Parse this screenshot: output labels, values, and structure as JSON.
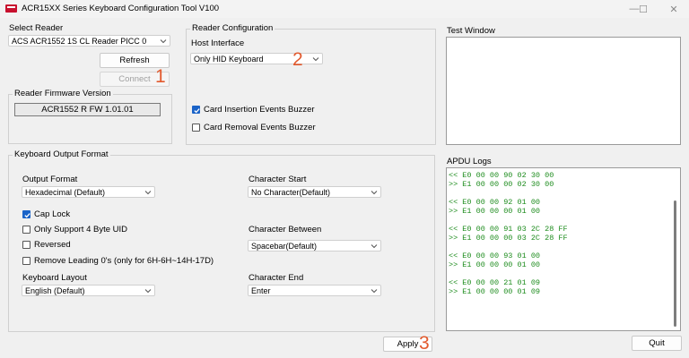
{
  "window": {
    "title": "ACR15XX Series Keyboard Configuration Tool V100",
    "minimize": "—",
    "maximize": "☐",
    "close": "✕"
  },
  "select_reader": {
    "title": "Select Reader",
    "reader_value": "ACS ACR1552 1S CL Reader PICC 0",
    "refresh_label": "Refresh",
    "connect_label": "Connect",
    "firmware_title": "Reader Firmware Version",
    "firmware_value": "ACR1552 R FW 1.01.01"
  },
  "reader_config": {
    "title": "Reader Configuration",
    "host_interface_label": "Host Interface",
    "host_interface_value": "Only HID Keyboard",
    "insertion_buzzer_label": "Card Insertion Events Buzzer",
    "insertion_buzzer_checked": true,
    "removal_buzzer_label": "Card Removal Events Buzzer",
    "removal_buzzer_checked": false
  },
  "test_window": {
    "title": "Test Window"
  },
  "keyboard_output": {
    "title": "Keyboard Output Format",
    "output_format_label": "Output Format",
    "output_format_value": "Hexadecimal (Default)",
    "cap_lock_label": "Cap Lock",
    "cap_lock_checked": true,
    "four_byte_label": "Only Support 4 Byte UID",
    "reversed_label": "Reversed",
    "remove_zeros_label": "Remove Leading 0's (only for 6H-6H~14H-17D)",
    "layout_label": "Keyboard Layout",
    "layout_value": "English (Default)",
    "char_start_label": "Character Start",
    "char_start_value": "No Character(Default)",
    "char_between_label": "Character Between",
    "char_between_value": "Spacebar(Default)",
    "char_end_label": "Character End",
    "char_end_value": "Enter"
  },
  "apdu_logs": {
    "title": "APDU Logs",
    "lines": [
      "<< E0 00 00 90 02 30 00",
      ">> E1 00 00 00 02 30 00",
      "",
      "<< E0 00 00 92 01 00",
      ">> E1 00 00 00 01 00",
      "",
      "<< E0 00 00 91 03 2C 28 FF",
      ">> E1 00 00 00 03 2C 28 FF",
      "",
      "<< E0 00 00 93 01 00",
      ">> E1 00 00 00 01 00",
      "",
      "<< E0 00 00 21 01 09",
      ">> E1 00 00 00 01 09"
    ]
  },
  "footer": {
    "apply_label": "Apply",
    "quit_label": "Quit"
  },
  "annotations": {
    "step1": "1",
    "step2": "2",
    "step3": "3"
  },
  "colors": {
    "accent": "#1a63c8",
    "log_text": "#1e8c1e",
    "annotation": "#e25a2e"
  }
}
